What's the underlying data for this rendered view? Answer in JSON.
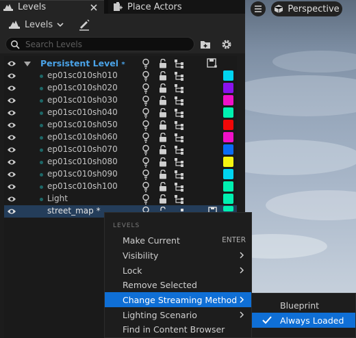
{
  "tabs": {
    "levels": "Levels",
    "place_actors": "Place Actors"
  },
  "toolbar": {
    "levels_dropdown": "Levels"
  },
  "search": {
    "placeholder": "Search Levels"
  },
  "levels": [
    {
      "name": "Persistent Level",
      "asterisk": "*",
      "color": null
    },
    {
      "name": "ep01sc010sh010",
      "color": "#00d4f0"
    },
    {
      "name": "ep01sc010sh020",
      "color": "#8a12ee"
    },
    {
      "name": "ep01sc010sh030",
      "color": "#f010c8"
    },
    {
      "name": "ep01sc010sh040",
      "color": "#00f0b0"
    },
    {
      "name": "ep01sc010sh050",
      "color": "#f00808"
    },
    {
      "name": "ep01sc010sh060",
      "color": "#f010c8"
    },
    {
      "name": "ep01sc010sh070",
      "color": "#0a6cf4"
    },
    {
      "name": "ep01sc010sh080",
      "color": "#f4f410"
    },
    {
      "name": "ep01sc010sh090",
      "color": "#00d4f0"
    },
    {
      "name": "ep01sc010sh100",
      "color": "#00f0b0"
    },
    {
      "name": "Light",
      "color": "#00f0b0"
    },
    {
      "name": "street_map",
      "asterisk": "*",
      "color": "#00f0b0"
    }
  ],
  "viewport": {
    "perspective": "Perspective"
  },
  "context_menu": {
    "header": "LEVELS",
    "items": [
      {
        "label": "Make Current",
        "shortcut": "ENTER"
      },
      {
        "label": "Visibility",
        "submenu": true
      },
      {
        "label": "Lock",
        "submenu": true
      },
      {
        "label": "Remove Selected"
      },
      {
        "label": "Change Streaming Method",
        "submenu": true,
        "highlighted": true
      },
      {
        "label": "Lighting Scenario",
        "submenu": true
      },
      {
        "label": "Find in Content Browser"
      }
    ]
  },
  "streaming_submenu": {
    "items": [
      {
        "label": "Blueprint"
      },
      {
        "label": "Always Loaded",
        "checked": true,
        "highlighted": true
      }
    ]
  },
  "colors": {
    "accent": "#0f6fd6",
    "persistent_level": "#4aa3e8",
    "selected_row": "#243d5a"
  }
}
